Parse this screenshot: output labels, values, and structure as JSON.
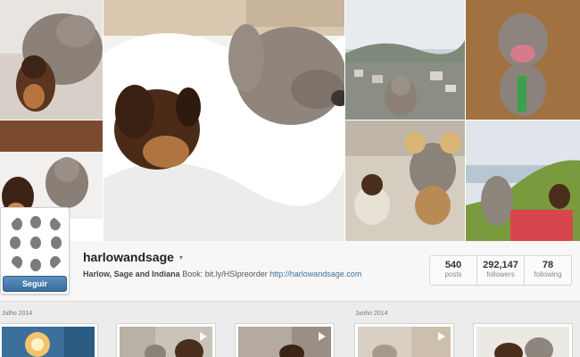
{
  "profile": {
    "username": "harlowandsage",
    "caret": "▾",
    "bio_name": "Harlow, Sage and Indiana",
    "bio_text": "Book: bit.ly/HSIpreorder",
    "bio_link": "http://harlowandsage.com",
    "follow_label": "Seguir"
  },
  "stats": [
    {
      "value": "540",
      "label": "posts"
    },
    {
      "value": "292,147",
      "label": "followers"
    },
    {
      "value": "78",
      "label": "following"
    }
  ],
  "feed": {
    "months": [
      "Julho 2014",
      "Junho 2014"
    ]
  },
  "colors": {
    "accent": "#3f729b",
    "follow_button": "#4a7fb0"
  }
}
